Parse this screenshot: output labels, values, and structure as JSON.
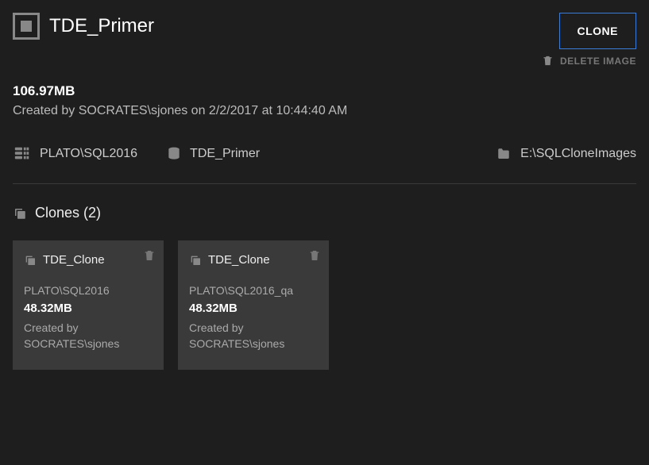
{
  "header": {
    "title": "TDE_Primer",
    "clone_button": "CLONE",
    "delete_link": "DELETE IMAGE"
  },
  "image": {
    "size": "106.97MB",
    "created_text": "Created by SOCRATES\\sjones on 2/2/2017 at 10:44:40 AM",
    "server": "PLATO\\SQL2016",
    "db_name": "TDE_Primer",
    "folder": "E:\\SQLCloneImages"
  },
  "clones": {
    "heading": "Clones (2)",
    "items": [
      {
        "name": "TDE_Clone",
        "server": "PLATO\\SQL2016",
        "size": "48.32MB",
        "created_label": "Created by",
        "created_by": "SOCRATES\\sjones"
      },
      {
        "name": "TDE_Clone",
        "server": "PLATO\\SQL2016_qa",
        "size": "48.32MB",
        "created_label": "Created by",
        "created_by": "SOCRATES\\sjones"
      }
    ]
  }
}
